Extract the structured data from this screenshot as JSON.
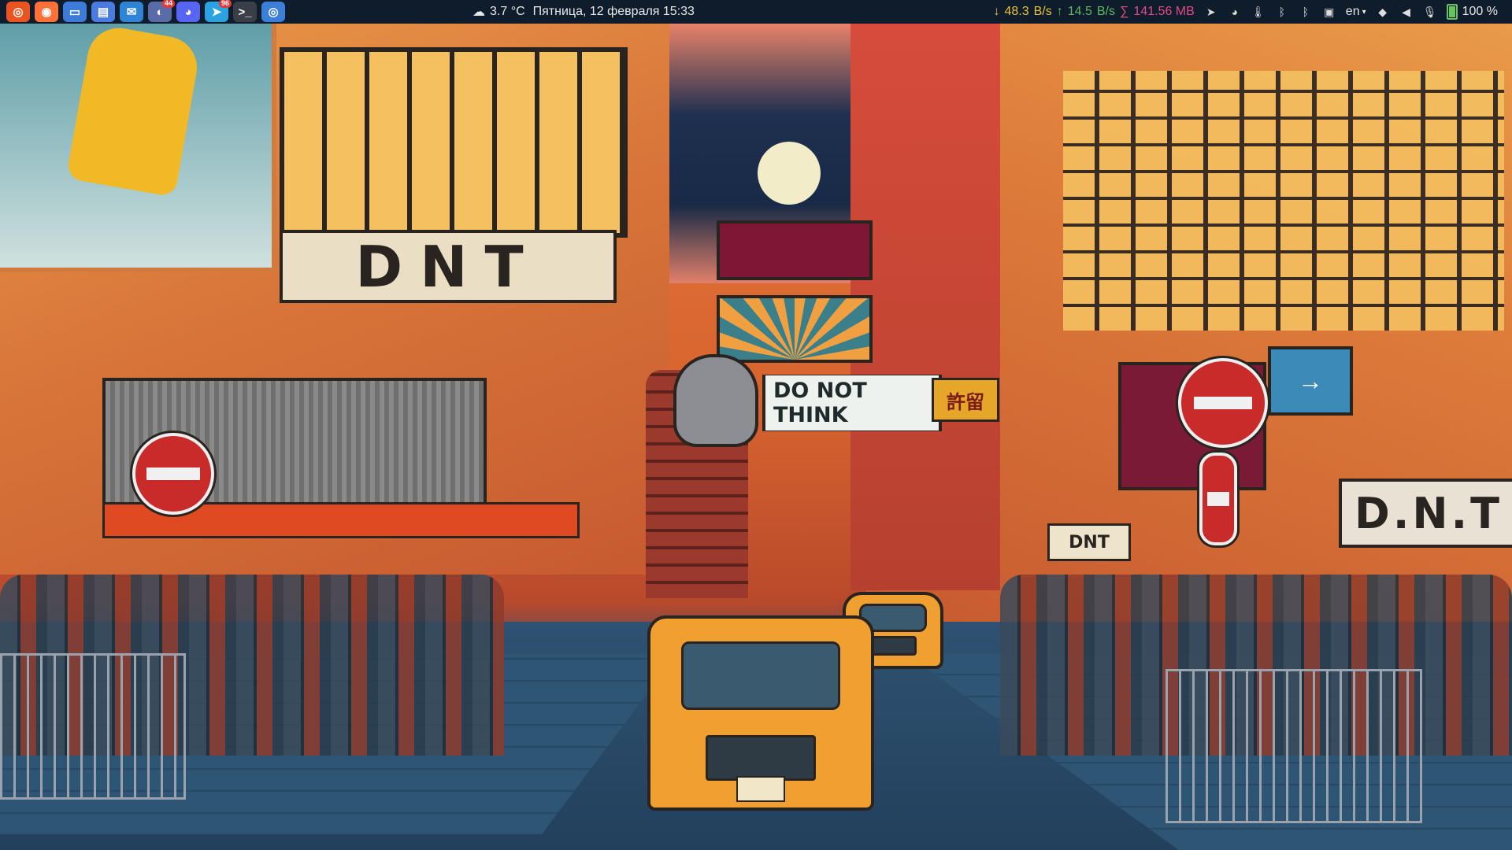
{
  "panel": {
    "apps": [
      {
        "name": "ubuntu-launcher",
        "icon": "ubuntu-icon",
        "color": "#e95420",
        "glyph": "◎",
        "badge": ""
      },
      {
        "name": "firefox",
        "icon": "firefox-icon",
        "color": "#ff7139",
        "glyph": "◉",
        "badge": ""
      },
      {
        "name": "files",
        "icon": "folder-icon",
        "color": "#3d7bd9",
        "glyph": "▭",
        "badge": ""
      },
      {
        "name": "calendar",
        "icon": "calendar-icon",
        "color": "#4a7be0",
        "glyph": "▤",
        "badge": ""
      },
      {
        "name": "mail",
        "icon": "mail-icon",
        "color": "#2f84d6",
        "glyph": "✉",
        "badge": ""
      },
      {
        "name": "messenger",
        "icon": "chat-icon",
        "color": "#5a6ba8",
        "glyph": "◐",
        "badge": "44"
      },
      {
        "name": "discord",
        "icon": "discord-icon",
        "color": "#5865f2",
        "glyph": "◕",
        "badge": ""
      },
      {
        "name": "telegram",
        "icon": "telegram-icon",
        "color": "#2aa3e0",
        "glyph": "➤",
        "badge": "96"
      },
      {
        "name": "terminal",
        "icon": "terminal-icon",
        "color": "#3a3f47",
        "glyph": ">_",
        "badge": ""
      },
      {
        "name": "chromium",
        "icon": "chromium-icon",
        "color": "#3b7fd8",
        "glyph": "◎",
        "badge": ""
      }
    ],
    "weather_temp": "3.7 °C",
    "datetime": "Пятница, 12 февраля 15:33",
    "net_down_arrow": "↓",
    "net_down": "48.3",
    "net_down_unit": "B/s",
    "net_up_arrow": "↑",
    "net_up": "14.5",
    "net_up_unit": "B/s",
    "net_total_symbol": "∑",
    "net_total": "141.56 MB",
    "tray_icons": [
      "telegram-tray-icon",
      "discord-tray-icon",
      "temperature-icon",
      "bluetooth-icon",
      "bluetooth-icon",
      "screenshot-icon"
    ],
    "tray_glyphs": [
      "➤",
      "◕",
      "🌡",
      "ᛒ",
      "ᛒ",
      "▣"
    ],
    "language": "en",
    "volume": "100 %",
    "colors": {
      "down": "#e8c33a",
      "up": "#5fb95f",
      "total": "#e24a88",
      "battery": "#66c35f"
    }
  },
  "wallpaper": {
    "sign_dnt_top": "DNT",
    "sign_do_not_think": "DO NOT THINK",
    "sign_chinese": "許留",
    "sign_dnt_right": "D.N.T",
    "sign_dnt_small": "DNT"
  }
}
